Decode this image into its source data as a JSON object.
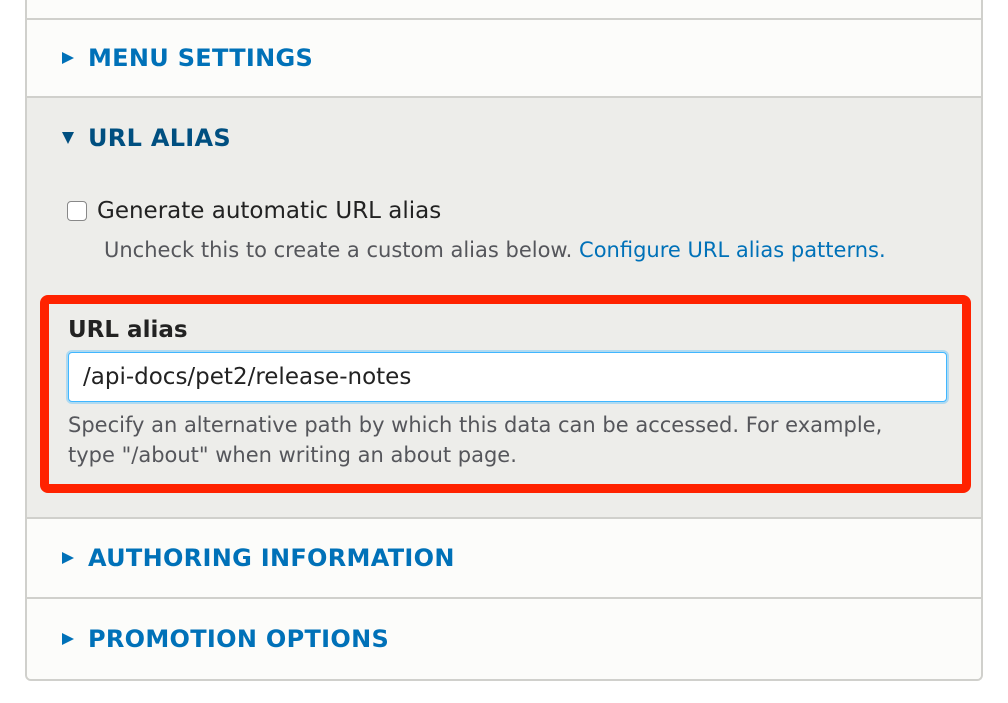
{
  "sections": {
    "menu_settings": {
      "title": "MENU SETTINGS",
      "expanded": false
    },
    "url_alias": {
      "title": "URL ALIAS",
      "expanded": true
    },
    "authoring_information": {
      "title": "AUTHORING INFORMATION",
      "expanded": false
    },
    "promotion_options": {
      "title": "PROMOTION OPTIONS",
      "expanded": false
    }
  },
  "url_alias": {
    "checkbox_label": "Generate automatic URL alias",
    "checkbox_checked": false,
    "checkbox_description": "Uncheck this to create a custom alias below.",
    "configure_link": "Configure URL alias patterns.",
    "field_label": "URL alias",
    "field_value": "/api-docs/pet2/release-notes",
    "field_description": "Specify an alternative path by which this data can be accessed. For example, type \"/about\" when writing an about page."
  },
  "colors": {
    "link": "#0071b8",
    "highlight": "#ff2200",
    "focus": "#40b6ff"
  },
  "icons": {
    "collapsed": "triangle-right-icon",
    "expanded": "triangle-down-icon"
  }
}
